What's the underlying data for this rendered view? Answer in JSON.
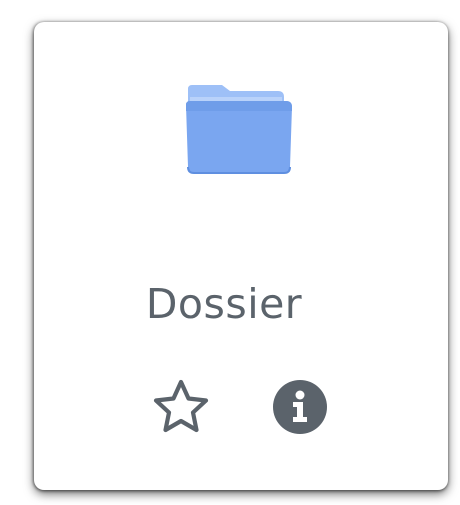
{
  "item": {
    "name": "Dossier",
    "icon": "folder-icon",
    "folder_color": "#7aa6f0"
  },
  "actions": {
    "favorite_icon": "star-icon",
    "info_icon": "info-icon",
    "icon_color": "#5b636b"
  }
}
